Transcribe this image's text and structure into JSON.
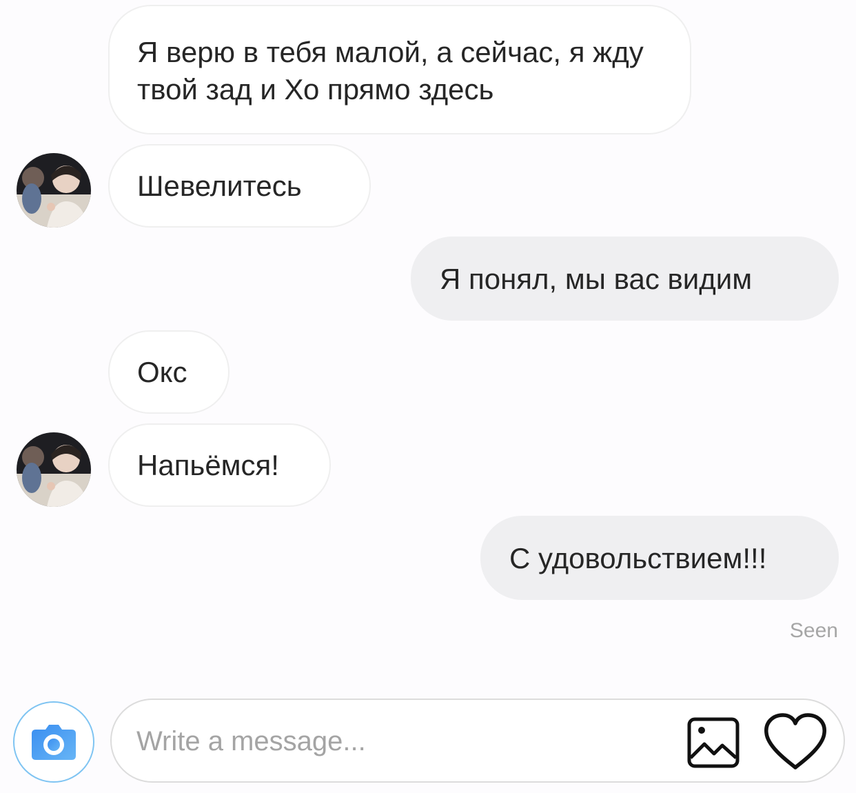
{
  "messages": [
    {
      "side": "incoming",
      "text": "Я верю в тебя малой, а сейчас, я жду твой зад и Хо прямо здесь",
      "avatar": false
    },
    {
      "side": "incoming",
      "text": "Шевелитесь",
      "avatar": true
    },
    {
      "side": "outgoing",
      "text": "Я понял, мы вас видим"
    },
    {
      "side": "incoming",
      "text": "Окс",
      "avatar": false
    },
    {
      "side": "incoming",
      "text": "Напьёмся!",
      "avatar": true
    },
    {
      "side": "outgoing",
      "text": "С удовольствием!!!"
    }
  ],
  "status": {
    "seen_label": "Seen"
  },
  "composer": {
    "placeholder": "Write a message...",
    "camera_icon": "camera-icon",
    "gallery_icon": "image-gallery-icon",
    "like_icon": "heart-icon"
  },
  "colors": {
    "camera_gradient_start": "#3a8ef0",
    "camera_gradient_end": "#67b5f6",
    "outgoing_bubble": "#efeff1",
    "incoming_border": "#efefef",
    "text": "#262626",
    "muted_text": "#a6a6a6"
  }
}
